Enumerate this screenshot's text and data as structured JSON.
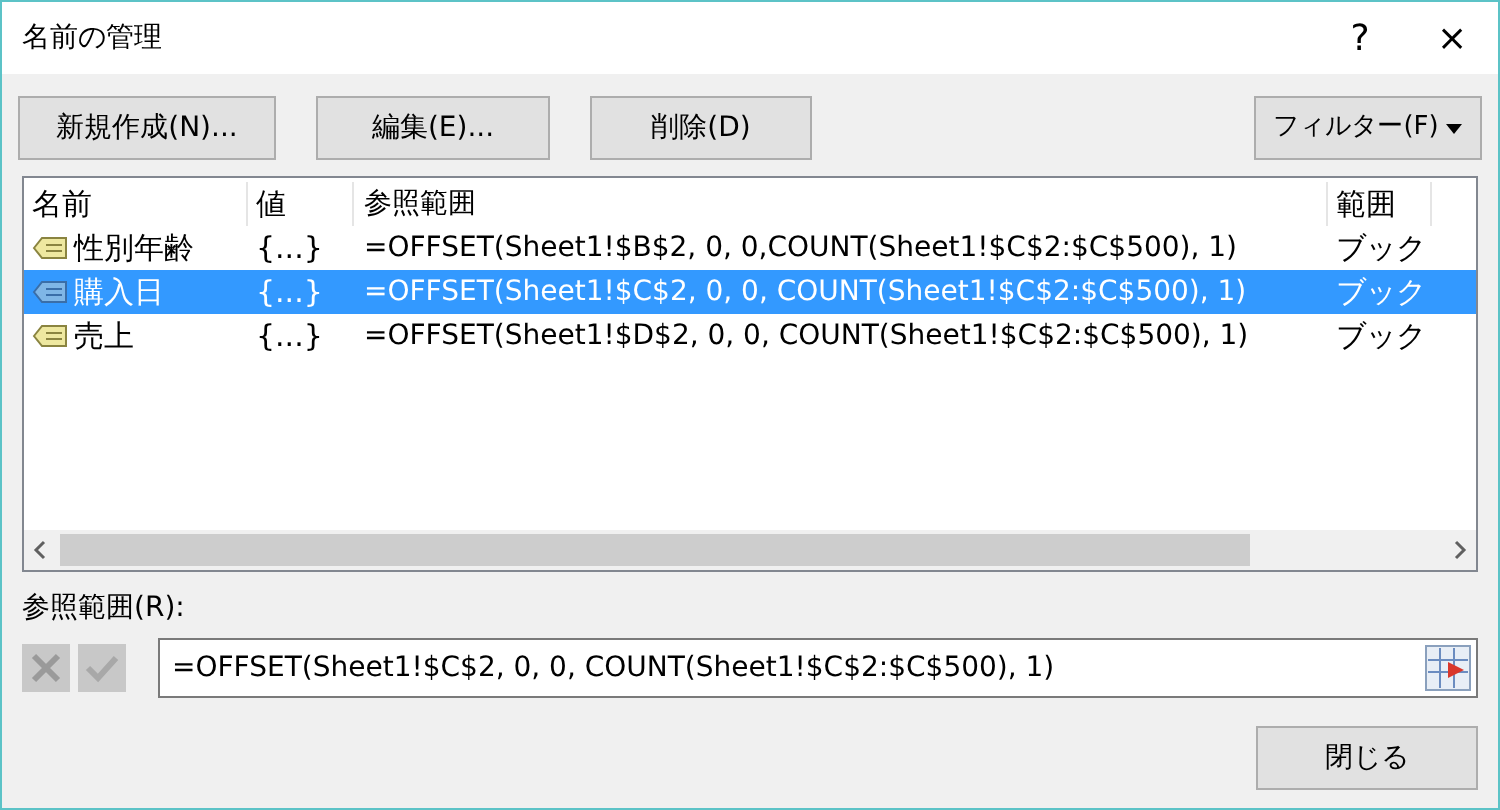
{
  "window": {
    "title": "名前の管理",
    "help": "?",
    "close": "×"
  },
  "toolbar": {
    "buttons": [
      "新規作成(N)...",
      "編集(E)...",
      "削除(D)"
    ],
    "filter": "フィルター(F)"
  },
  "table": {
    "columns": [
      "名前",
      "値",
      "参照範囲",
      "範囲"
    ],
    "rows": [
      {
        "name": "性別年齢",
        "value": "{...}",
        "refers_to": "=OFFSET(Sheet1!$B$2, 0, 0,COUNT(Sheet1!$C$2:$C$500), 1)",
        "scope": "ブック",
        "selected": false
      },
      {
        "name": "購入日",
        "value": "{...}",
        "refers_to": "=OFFSET(Sheet1!$C$2, 0, 0, COUNT(Sheet1!$C$2:$C$500), 1)",
        "scope": "ブック",
        "selected": true
      },
      {
        "name": "売上",
        "value": "{...}",
        "refers_to": "=OFFSET(Sheet1!$D$2, 0, 0, COUNT(Sheet1!$C$2:$C$500), 1)",
        "scope": "ブック",
        "selected": false
      }
    ]
  },
  "refers_to": {
    "label": "参照範囲(R):",
    "value": "=OFFSET(Sheet1!$C$2, 0, 0, COUNT(Sheet1!$C$2:$C$500), 1)"
  },
  "footer": {
    "close_button": "閉じる"
  }
}
